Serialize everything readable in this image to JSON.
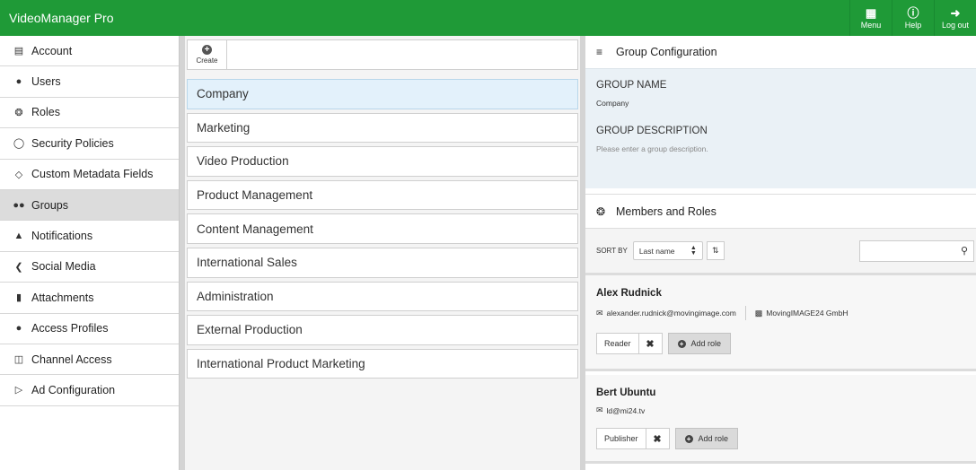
{
  "app": {
    "title": "VideoManager Pro"
  },
  "topbar": {
    "buttons": [
      {
        "label": "Menu",
        "icon": "grid-icon"
      },
      {
        "label": "Help",
        "icon": "help-icon"
      },
      {
        "label": "Log out",
        "icon": "logout-icon"
      }
    ]
  },
  "colors": {
    "brand": "#1f9a37",
    "selected_group": "#e3f1fb",
    "config_bg": "#eaf1f6"
  },
  "sidebar": {
    "items": [
      {
        "label": "Account",
        "icon": "account-icon"
      },
      {
        "label": "Users",
        "icon": "user-icon"
      },
      {
        "label": "Roles",
        "icon": "gavel-icon"
      },
      {
        "label": "Security Policies",
        "icon": "shield-icon"
      },
      {
        "label": "Custom Metadata Fields",
        "icon": "tag-icon"
      },
      {
        "label": "Groups",
        "icon": "group-icon",
        "active": true
      },
      {
        "label": "Notifications",
        "icon": "bell-icon"
      },
      {
        "label": "Social Media",
        "icon": "share-icon"
      },
      {
        "label": "Attachments",
        "icon": "file-icon"
      },
      {
        "label": "Access Profiles",
        "icon": "user-gear-icon"
      },
      {
        "label": "Channel Access",
        "icon": "channel-icon"
      },
      {
        "label": "Ad Configuration",
        "icon": "play-box-icon"
      }
    ]
  },
  "groups": {
    "create_label": "Create",
    "items": [
      "Company",
      "Marketing",
      "Video Production",
      "Product Management",
      "Content Management",
      "International Sales",
      "Administration",
      "External Production",
      "International Product Marketing"
    ],
    "selected": "Company"
  },
  "config": {
    "header": "Group Configuration",
    "name_label": "GROUP NAME",
    "name_value": "Company",
    "desc_label": "GROUP DESCRIPTION",
    "desc_placeholder": "Please enter a group description."
  },
  "members": {
    "header": "Members and Roles",
    "sort_label": "SORT BY",
    "sort_value": "Last name",
    "search_value": "",
    "add_role_label": "Add role",
    "list": [
      {
        "name": "Alex Rudnick",
        "email": "alexander.rudnick@movingimage.com",
        "company": "MovingIMAGE24 GmbH",
        "role": "Reader"
      },
      {
        "name": "Bert Ubuntu",
        "email": "ld@mi24.tv",
        "role": "Publisher"
      }
    ]
  }
}
